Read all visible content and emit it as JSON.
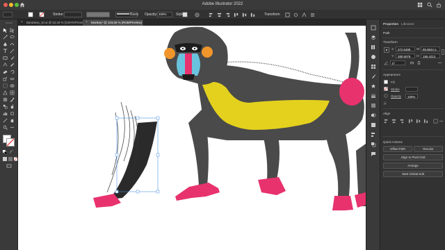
{
  "window": {
    "title": "Adobe Illustrator 2022"
  },
  "control_bar": {
    "stroke_label": "Stroke:",
    "brush_label": "Basic",
    "opacity_label": "Opacity:",
    "opacity_value": "100%",
    "style_label": "Style:",
    "transform_label": "Transform"
  },
  "tabs": [
    {
      "label": "Bardaksa_10.ai @ 52,29 % (CMYK/Preview)",
      "active": false
    },
    {
      "label": "Monkey* @ 103,06 % (RGB/Preview)",
      "active": true
    }
  ],
  "panel": {
    "tab_properties": "Properties",
    "tab_libraries": "Libraries",
    "object_type": "Path",
    "transform": {
      "title": "Transform",
      "x": "372,5488",
      "y": "380,5079",
      "w": "85,8844 p",
      "h": "155,4213",
      "angle": "0°"
    },
    "appearance": {
      "title": "Appearance",
      "fill_label": "Fill",
      "stroke_label": "Stroke",
      "opacity_label": "Opacity",
      "opacity_value": "100%"
    },
    "align": {
      "title": "Align"
    },
    "quick_actions": {
      "title": "Quick Actions",
      "offset_path": "Offset Path",
      "recolor": "Recolor",
      "align_pixel_grid": "Align to Pixel Grid",
      "arrange": "Arrange",
      "start_global_edit": "Start Global Edit"
    }
  },
  "colors": {
    "monkey_body": "#4a4a4a",
    "muzzle_red": "#e8326e",
    "nose_blue": "#6ac3de",
    "chest_yellow": "#e4d11e",
    "ear_orange": "#f0962a",
    "hand_pink": "#e8326e",
    "selection_blue": "#4a90e2"
  }
}
